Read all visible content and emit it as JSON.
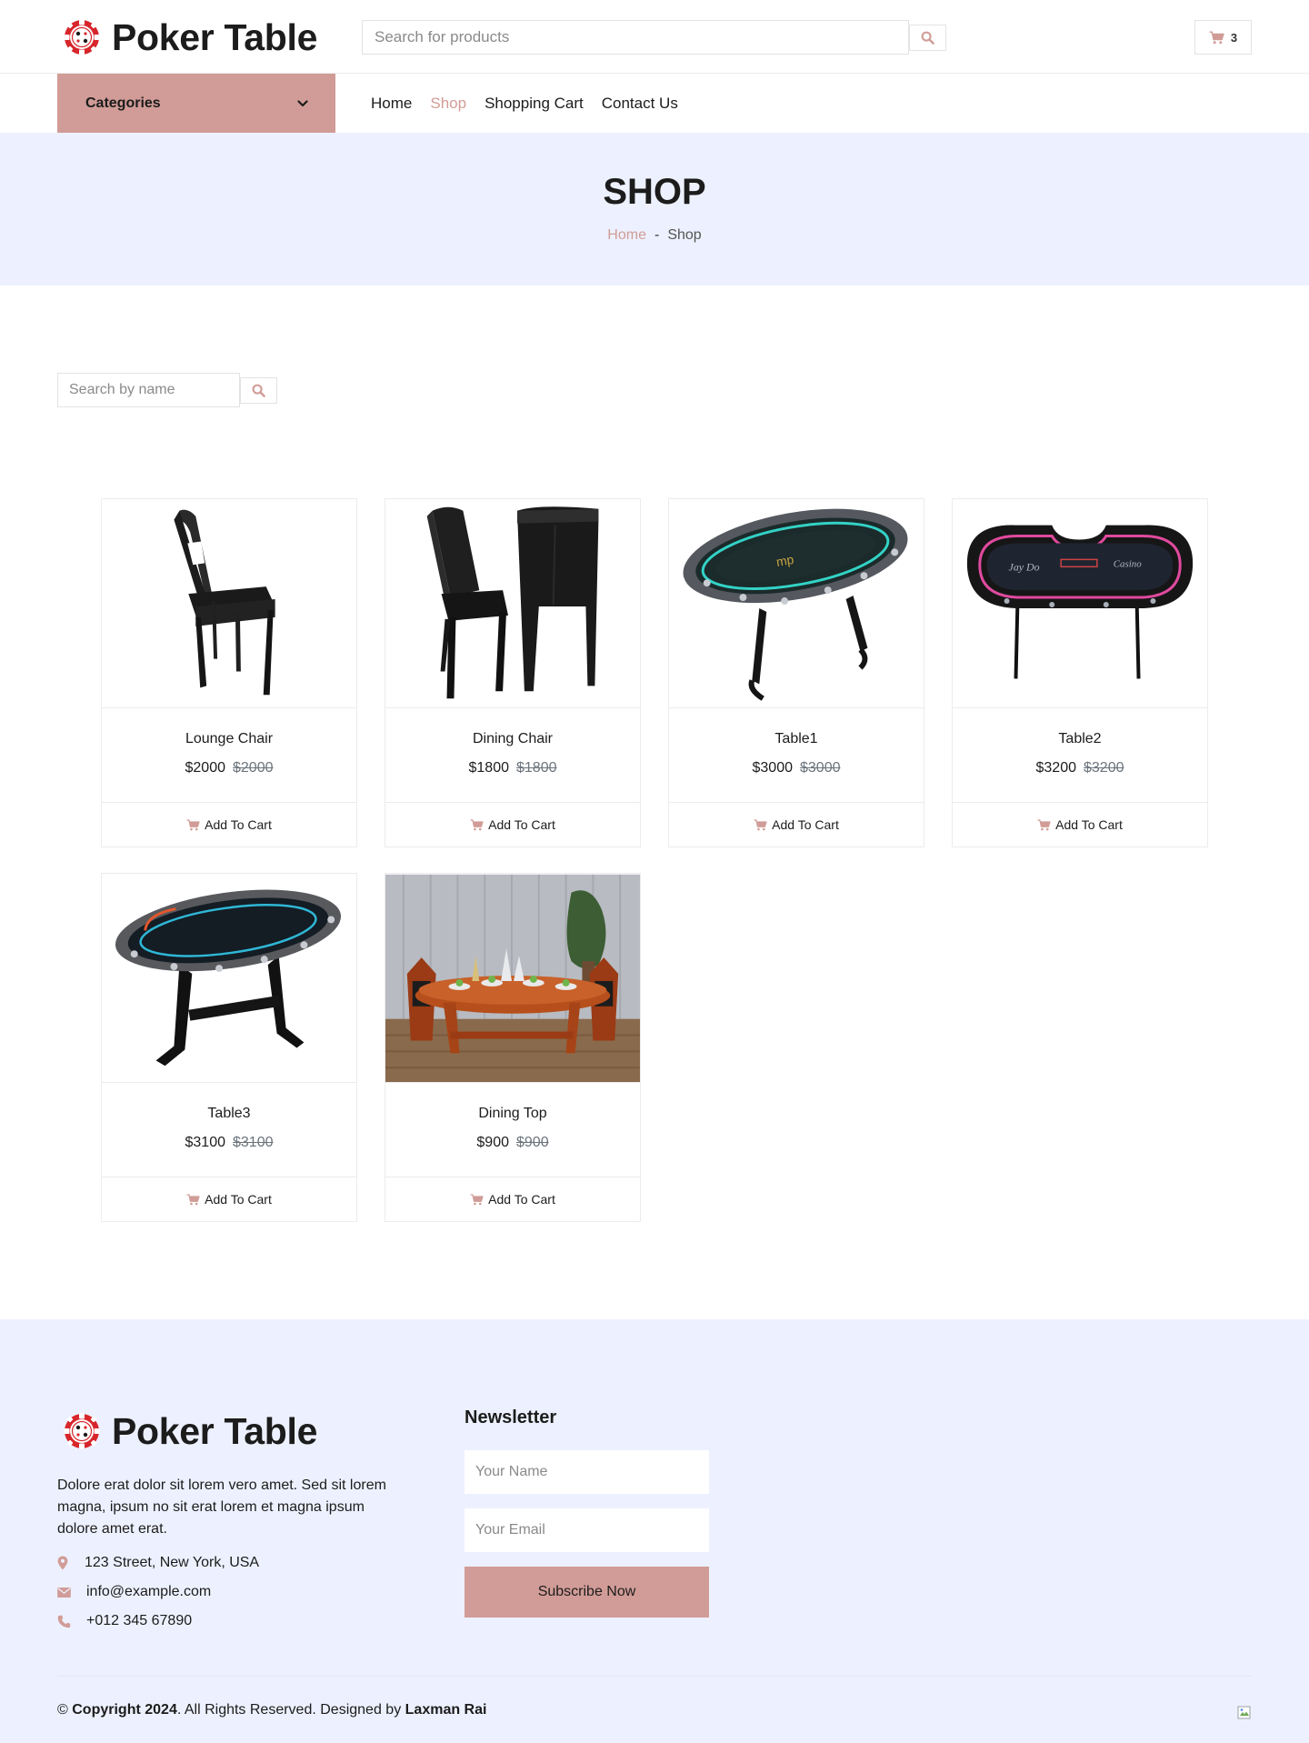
{
  "brand": {
    "name": "Poker Table"
  },
  "header": {
    "search_placeholder": "Search for products",
    "cart_count": "3"
  },
  "nav": {
    "categories_label": "Categories",
    "links": [
      "Home",
      "Shop",
      "Shopping Cart",
      "Contact Us"
    ],
    "active": "Shop"
  },
  "page_header": {
    "title": "SHOP",
    "breadcrumb": {
      "home": "Home",
      "separator": "-",
      "current": "Shop"
    }
  },
  "shop": {
    "search_placeholder": "Search by name",
    "add_to_cart_label": "Add To Cart",
    "products": [
      {
        "name": "Lounge Chair",
        "price": "$2000",
        "old_price": "$2000",
        "image": "lounge-chair"
      },
      {
        "name": "Dining Chair",
        "price": "$1800",
        "old_price": "$1800",
        "image": "dining-chairs"
      },
      {
        "name": "Table1",
        "price": "$3000",
        "old_price": "$3000",
        "image": "poker-table-green"
      },
      {
        "name": "Table2",
        "price": "$3200",
        "old_price": "$3200",
        "image": "poker-table-led"
      },
      {
        "name": "Table3",
        "price": "$3100",
        "old_price": "$3100",
        "image": "poker-table-pedestal"
      },
      {
        "name": "Dining Top",
        "price": "$900",
        "old_price": "$900",
        "image": "dining-set-room"
      }
    ]
  },
  "footer": {
    "brand_name": "Poker Table",
    "description": "Dolore erat dolor sit lorem vero amet. Sed sit lorem magna, ipsum no sit erat lorem et magna ipsum dolore amet erat.",
    "address": "123 Street, New York, USA",
    "email": "info@example.com",
    "phone": "+012 345 67890",
    "newsletter": {
      "title": "Newsletter",
      "name_placeholder": "Your Name",
      "email_placeholder": "Your Email",
      "button_label": "Subscribe Now"
    },
    "copyright": {
      "prefix": "©",
      "bold_part": "Copyright 2024",
      "middle": ". All Rights Reserved. Designed by",
      "author": "Laxman Rai"
    }
  },
  "colors": {
    "accent": "#d19c97",
    "header_bg": "#edf1ff",
    "text": "#1c1c1c",
    "muted": "#6c757d"
  }
}
